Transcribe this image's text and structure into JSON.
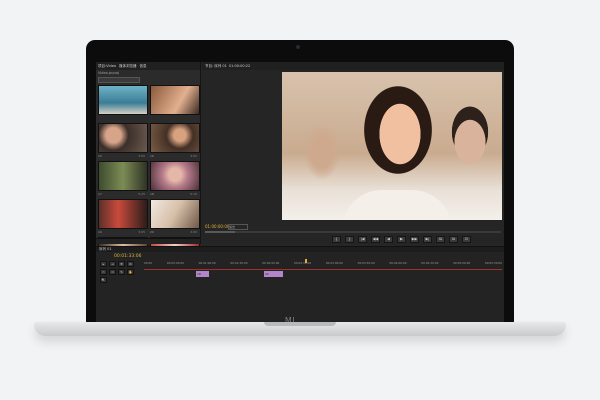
{
  "device": {
    "brand_logo": "MI"
  },
  "project_panel": {
    "tabs": [
      "项目:Video",
      "媒体浏览器",
      "信息"
    ],
    "project_name": "Video.prproj",
    "clips": [
      {
        "label": "",
        "duration": ""
      },
      {
        "label": "",
        "duration": ""
      },
      {
        "label": "15",
        "duration": "3:05"
      },
      {
        "label": "16",
        "duration": "3:05"
      },
      {
        "label": "17",
        "duration": "5:25"
      },
      {
        "label": "18",
        "duration": "5:10"
      },
      {
        "label": "19",
        "duration": "3:05"
      },
      {
        "label": "20",
        "duration": "3:05"
      },
      {
        "label": "21",
        "duration": "3:05"
      },
      {
        "label": "22",
        "duration": "3:05"
      }
    ]
  },
  "program_monitor": {
    "tabs": [
      "节目: 序列 01",
      "01:00:00:22"
    ],
    "timecode": "01:00:00:00",
    "fit": "适合",
    "controls": [
      "{",
      "}",
      "|◀",
      "◀◀",
      "◀",
      "▶",
      "▶▶",
      "▶|",
      "⧉",
      "⧉",
      "⊡"
    ]
  },
  "timeline": {
    "tab": "序列 01",
    "timecode": "00:01:33:06",
    "ruler": [
      "00:00",
      "00:00:30:00",
      "00:01:00:00",
      "00:01:30:00",
      "00:02:00:00",
      "00:02:30:00",
      "00:03:00:00",
      "00:03:30:00",
      "00:04:00:00",
      "00:04:30:00",
      "00:05:00:00",
      "00:05:30:00"
    ],
    "tools": [
      "▸",
      "⇥",
      "✥",
      "⧉",
      "✂",
      "⇔",
      "✎",
      "✋",
      "🔍"
    ],
    "clips": [
      {
        "label": "18",
        "start": 100,
        "end": 112
      },
      {
        "label": "22",
        "start": 168,
        "end": 186
      }
    ]
  }
}
